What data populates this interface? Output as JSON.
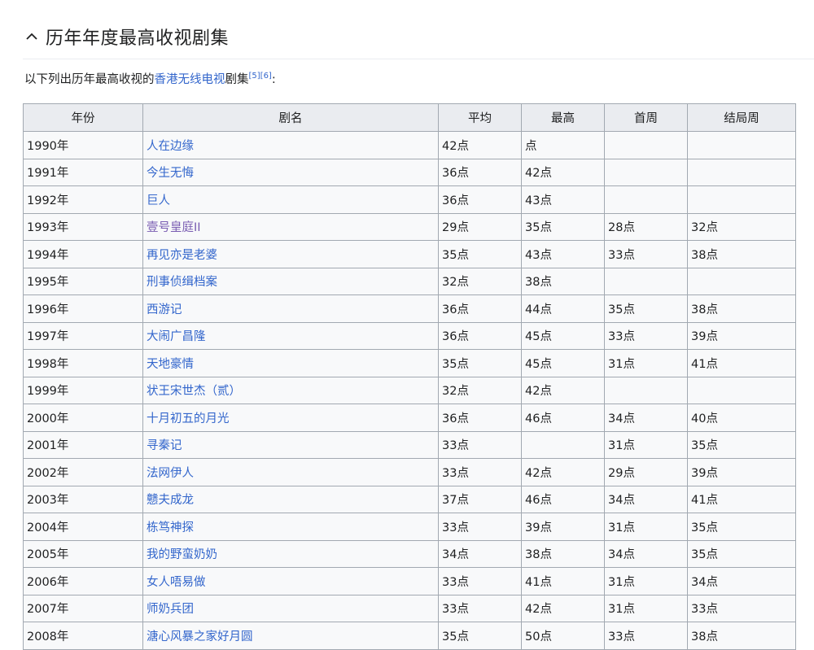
{
  "section": {
    "title": "历年年度最高收视剧集"
  },
  "intro": {
    "prefix": "以下列出历年最高收视的",
    "link": "香港无线电视",
    "suffix_before_ref": "剧集",
    "refs": "[5][6]",
    "end": ":"
  },
  "table": {
    "headers": [
      "年份",
      "剧名",
      "平均",
      "最高",
      "首周",
      "结局周"
    ],
    "rows": [
      [
        "1990年",
        "人在边缘",
        "42点",
        "点",
        "",
        ""
      ],
      [
        "1991年",
        "今生无悔",
        "36点",
        "42点",
        "",
        ""
      ],
      [
        "1992年",
        "巨人",
        "36点",
        "43点",
        "",
        ""
      ],
      [
        "1993年",
        "壹号皇庭II",
        "29点",
        "35点",
        "28点",
        "32点"
      ],
      [
        "1994年",
        "再见亦是老婆",
        "35点",
        "43点",
        "33点",
        "38点"
      ],
      [
        "1995年",
        "刑事侦缉档案",
        "32点",
        "38点",
        "",
        ""
      ],
      [
        "1996年",
        "西游记",
        "36点",
        "44点",
        "35点",
        "38点"
      ],
      [
        "1997年",
        "大闹广昌隆",
        "36点",
        "45点",
        "33点",
        "39点"
      ],
      [
        "1998年",
        "天地豪情",
        "35点",
        "45点",
        "31点",
        "41点"
      ],
      [
        "1999年",
        "状王宋世杰（贰）",
        "32点",
        "42点",
        "",
        ""
      ],
      [
        "2000年",
        "十月初五的月光",
        "36点",
        "46点",
        "34点",
        "40点"
      ],
      [
        "2001年",
        "寻秦记",
        "33点",
        "",
        "31点",
        "35点"
      ],
      [
        "2002年",
        "法网伊人",
        "33点",
        "42点",
        "29点",
        "39点"
      ],
      [
        "2003年",
        "戆夫成龙",
        "37点",
        "46点",
        "34点",
        "41点"
      ],
      [
        "2004年",
        "栋笃神探",
        "33点",
        "39点",
        "31点",
        "35点"
      ],
      [
        "2005年",
        "我的野蛮奶奶",
        "34点",
        "38点",
        "34点",
        "35点"
      ],
      [
        "2006年",
        "女人唔易做",
        "33点",
        "41点",
        "31点",
        "34点"
      ],
      [
        "2007年",
        "师奶兵团",
        "33点",
        "42点",
        "31点",
        "33点"
      ],
      [
        "2008年",
        "溏心风暴之家好月圆",
        "35点",
        "50点",
        "33点",
        "38点"
      ]
    ]
  },
  "colors": {
    "link": "#3366cc",
    "visited_link": "#795cb2",
    "header_bg": "#eaecf0",
    "cell_bg": "#f8f9fa",
    "border": "#a2a9b1"
  },
  "icons": {
    "collapse": "chevron-up-icon"
  }
}
